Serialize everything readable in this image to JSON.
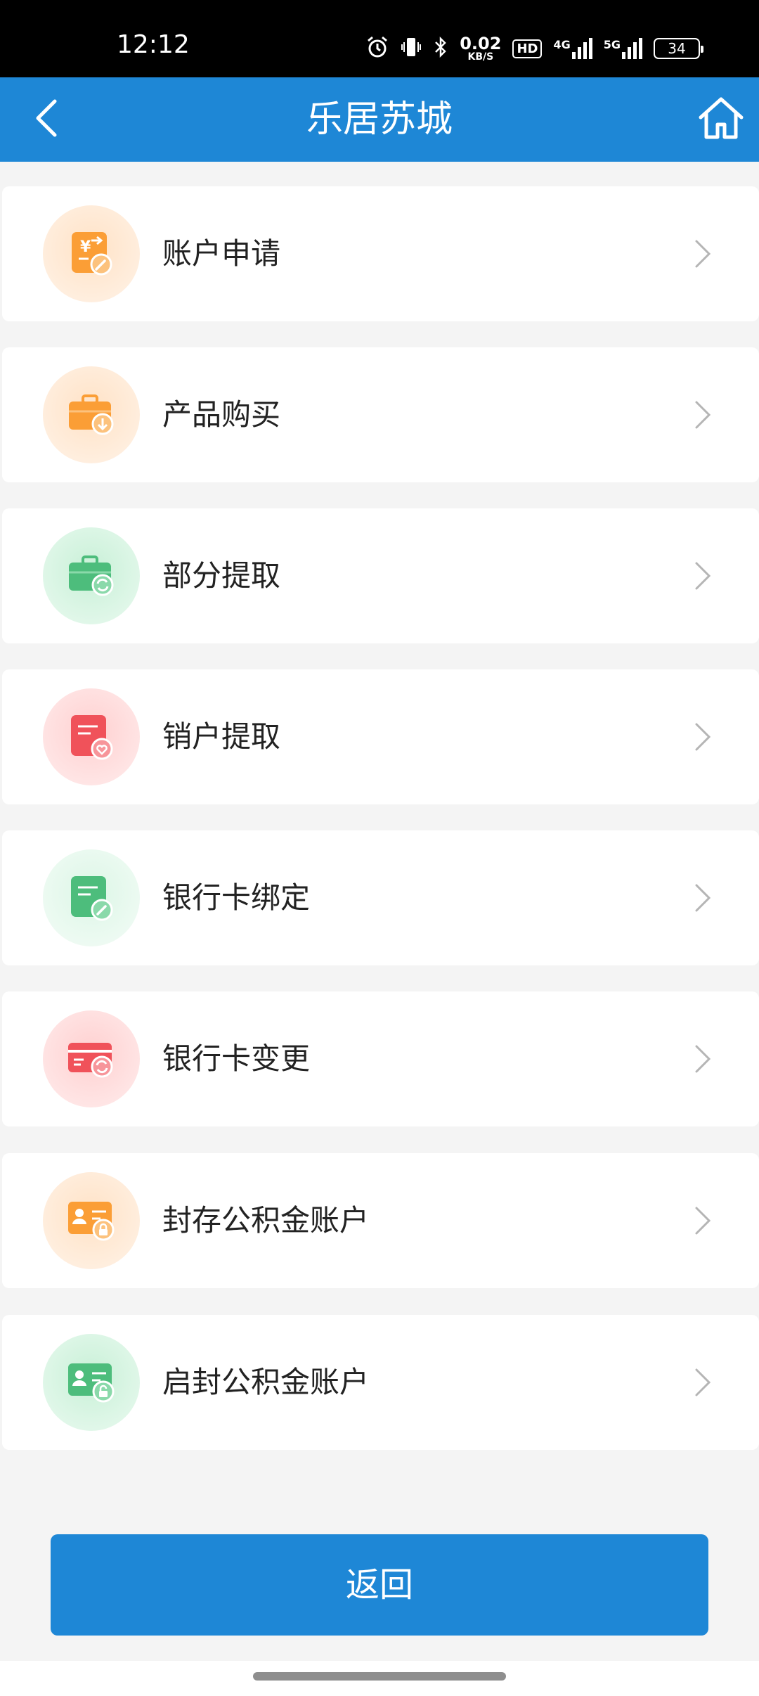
{
  "status_bar": {
    "time": "12:12",
    "net_speed": "0.02",
    "net_speed_unit": "KB/S",
    "hd_label": "HD",
    "net1_label": "4G",
    "net2_label": "5G",
    "battery": "34"
  },
  "header": {
    "title": "乐居苏城",
    "back_icon": "chevron-left-icon",
    "home_icon": "home-icon"
  },
  "menu": {
    "items": [
      {
        "label": "账户申请",
        "icon": "account-apply-icon",
        "color": "#fb9e36",
        "bg": "#fff1e4"
      },
      {
        "label": "产品购买",
        "icon": "briefcase-download-icon",
        "color": "#fb9e36",
        "bg": "#fff1e4"
      },
      {
        "label": "部分提取",
        "icon": "briefcase-refresh-icon",
        "color": "#4dbd7c",
        "bg": "#e6f8ed"
      },
      {
        "label": "销户提取",
        "icon": "document-heart-icon",
        "color": "#f0525a",
        "bg": "#ffe7e7"
      },
      {
        "label": "银行卡绑定",
        "icon": "document-edit-icon",
        "color": "#4dbd7c",
        "bg": "#eafaf0"
      },
      {
        "label": "银行卡变更",
        "icon": "card-refresh-icon",
        "color": "#f0525a",
        "bg": "#ffe7e7"
      },
      {
        "label": "封存公积金账户",
        "icon": "id-card-lock-icon",
        "color": "#fb9e36",
        "bg": "#fff1e4"
      },
      {
        "label": "启封公积金账户",
        "icon": "id-card-unlock-icon",
        "color": "#4dbd7c",
        "bg": "#e6f8ed"
      }
    ]
  },
  "footer": {
    "return_label": "返回"
  }
}
